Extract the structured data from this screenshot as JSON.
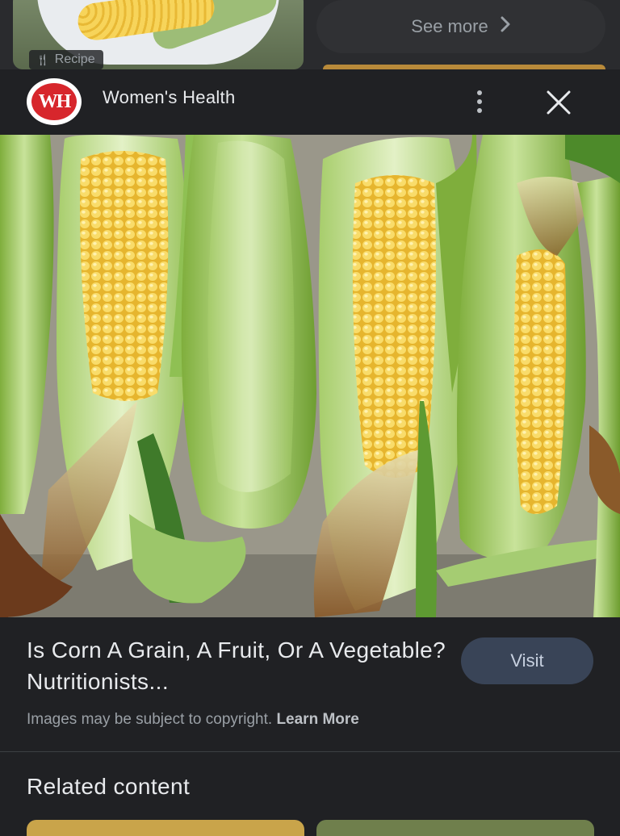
{
  "previous_results": {
    "recipe_label": "Recipe",
    "see_more_label": "See more",
    "see_more_icon": "chevron-right-icon"
  },
  "header": {
    "logo_text": "WH",
    "site_name": "Women's Health",
    "more_icon": "more-vertical-icon",
    "close_icon": "close-icon"
  },
  "image": {
    "lens_icon": "lens-icon"
  },
  "result": {
    "title": "Is Corn A Grain, A Fruit, Or A Vegetable? Nutritionists...",
    "visit_label": "Visit",
    "copyright_text": "Images may be subject to copyright.",
    "learn_more_label": "Learn More"
  },
  "related": {
    "heading": "Related content"
  },
  "colors": {
    "background": "#202124",
    "visit_button": "#394457",
    "logo_red": "#d7262c"
  }
}
